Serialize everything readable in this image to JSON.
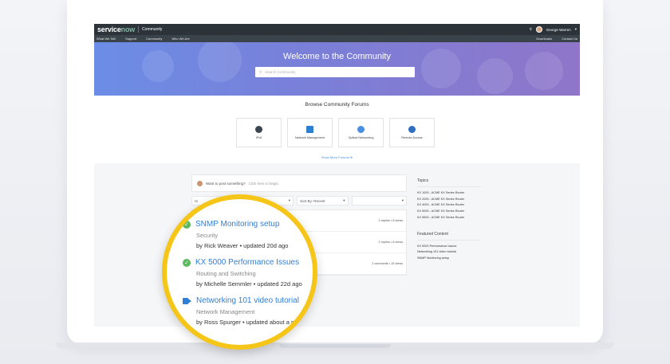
{
  "topbar": {
    "logo_service": "service",
    "logo_now": "now",
    "title": "Community",
    "user_name": "George Warren"
  },
  "nav": {
    "items": [
      "What We Sell",
      "Support",
      "Community",
      "Who We Are"
    ],
    "right_items": [
      "Downloads",
      "Contact Us"
    ]
  },
  "hero": {
    "title": "Welcome to the Community",
    "search_placeholder": "Search Community"
  },
  "browse": {
    "title": "Browse Community Forums",
    "forums": [
      {
        "label": "IPv6",
        "icon": "ipv6-icon",
        "color": "#3c4650"
      },
      {
        "label": "Network Management",
        "icon": "network-icon",
        "color": "#2e7fd0"
      },
      {
        "label": "Optical Networking",
        "icon": "optical-icon",
        "color": "#4b8fe0"
      },
      {
        "label": "Remote Access",
        "icon": "remote-icon",
        "color": "#2e6fbf"
      }
    ],
    "show_more": "Show More Forums ⊕"
  },
  "feed": {
    "post_prompt_bold": "Want to post something?",
    "post_prompt": " Click here to begin.",
    "filter1": "nt",
    "filter2": "A",
    "sort": "Sort By: Recent",
    "stats": [
      "3 replies • 8 views",
      "2 replies • 8 views",
      "2 comments • 15 views"
    ]
  },
  "sidebar": {
    "topics_title": "Topics",
    "topics": [
      "KX 1000 - ACME KX Series Router",
      "KX 2000 - ACME KX Series Router",
      "KX 4000 - ACME KX Series Router",
      "KX 5000 - ACME KX Series Router",
      "KX 5500 - ACME KX Series Router"
    ],
    "featured_title": "Featured Content",
    "featured": [
      "KX 5000 Performance Issues",
      "Networking 101 video tutorial",
      "SNMP Monitoring setup"
    ]
  },
  "magnified": [
    {
      "title": "SNMP Monitoring setup",
      "category": "Security",
      "meta": "by Rick Weaver • updated 20d ago",
      "icon": "check-icon"
    },
    {
      "title": "KX 5000 Performance Issues",
      "category": "Routing and Switching",
      "meta": "by Michelle Semmler • updated 22d ago",
      "icon": "check-icon"
    },
    {
      "title": "Networking 101 video tutorial",
      "category": "Network Management",
      "meta": "by Ross Spurger • updated about a m",
      "icon": "video-icon"
    }
  ],
  "colors": {
    "accent": "#2f7fd6",
    "highlight": "#f5c518",
    "success": "#5cb85c"
  }
}
